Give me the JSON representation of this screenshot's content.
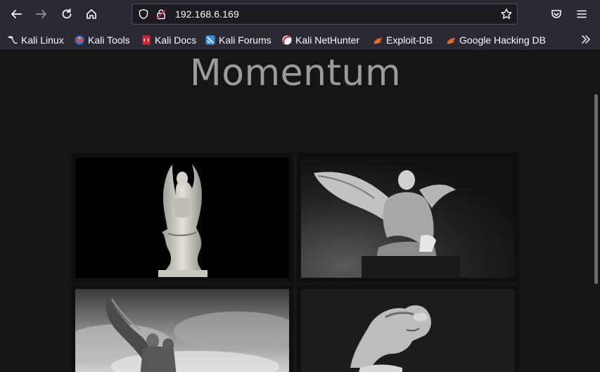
{
  "browser": {
    "url": "192.168.6.169",
    "bookmarks": [
      {
        "label": "Kali Linux",
        "icon": "kali-dragon-icon"
      },
      {
        "label": "Kali Tools",
        "icon": "kali-tools-icon"
      },
      {
        "label": "Kali Docs",
        "icon": "kali-docs-icon"
      },
      {
        "label": "Kali Forums",
        "icon": "kali-forums-icon"
      },
      {
        "label": "Kali NetHunter",
        "icon": "kali-nethunter-icon"
      },
      {
        "label": "Exploit-DB",
        "icon": "exploit-db-icon"
      },
      {
        "label": "Google Hacking DB",
        "icon": "ghdb-icon"
      }
    ]
  },
  "page": {
    "title": "Momentum",
    "gallery": [
      {
        "subject": "winged-statue-dark-background"
      },
      {
        "subject": "angel-statue-sky"
      },
      {
        "subject": "angel-statue-clouds"
      },
      {
        "subject": "statue-head-shadow"
      }
    ]
  },
  "colors": {
    "toolbar": "#2b2a33",
    "page_bg": "#151515",
    "title": "#9b9b9b"
  }
}
